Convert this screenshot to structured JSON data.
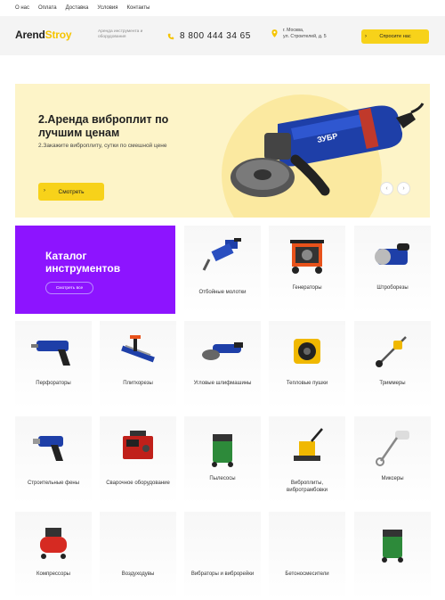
{
  "topnav": [
    "О нас",
    "Оплата",
    "Доставка",
    "Условия",
    "Контакты"
  ],
  "header": {
    "logo_main": "Arend",
    "logo_accent": "Stroy",
    "tagline": "Аренда инструмента и оборудования",
    "phone": "8 800 444 34 65",
    "address_line1": "г. Москва,",
    "address_line2": "ул. Строителей, д. 5",
    "cta": "Спросите нас"
  },
  "hero": {
    "title": "2.Аренда виброплит по лучшим ценам",
    "subtitle": "2.Закажите виброплиту, сутки по смешной цене",
    "button": "Смотреть",
    "product_label": "ЗУБР"
  },
  "catalog": {
    "title_line1": "Каталог",
    "title_line2": "инструментов",
    "button": "Смотреть все"
  },
  "categories": [
    {
      "label": "Отбойные молотки",
      "icon": "jackhammer-icon"
    },
    {
      "label": "Генераторы",
      "icon": "generator-icon"
    },
    {
      "label": "Штроборезы",
      "icon": "wall-chaser-icon"
    },
    {
      "label": "Перфораторы",
      "icon": "rotary-hammer-icon"
    },
    {
      "label": "Плиткорезы",
      "icon": "tile-cutter-icon"
    },
    {
      "label": "Угловые шлифмашины",
      "icon": "angle-grinder-icon"
    },
    {
      "label": "Тепловые пушки",
      "icon": "heat-gun-icon"
    },
    {
      "label": "Триммеры",
      "icon": "trimmer-icon"
    },
    {
      "label": "Строительные фены",
      "icon": "hot-air-gun-icon"
    },
    {
      "label": "Сварочное оборудование",
      "icon": "welder-icon"
    },
    {
      "label": "Пылесосы",
      "icon": "vacuum-icon"
    },
    {
      "label": "Виброплиты, вибротрамбовки",
      "icon": "plate-compactor-icon"
    },
    {
      "label": "Миксеры",
      "icon": "mixer-icon"
    },
    {
      "label": "Компрессоры",
      "icon": "compressor-icon"
    },
    {
      "label": "Воздуходувы",
      "icon": "blower-icon"
    },
    {
      "label": "Вибраторы и виброрейки",
      "icon": "vibrator-icon"
    },
    {
      "label": "Бетоносмесители",
      "icon": "concrete-mixer-icon"
    },
    {
      "label": "",
      "icon": "vacuum-icon"
    }
  ],
  "colors": {
    "accent": "#f7d21a",
    "catalog": "#8d14ff",
    "hero_bg": "#fdf4c8"
  }
}
